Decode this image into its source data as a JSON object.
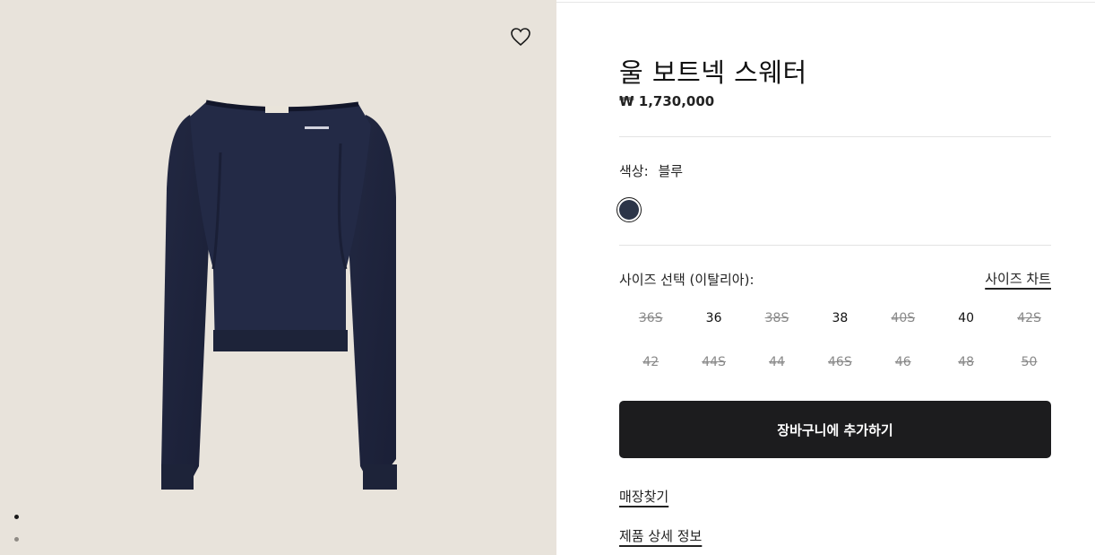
{
  "product": {
    "title": "울 보트넥 스웨터",
    "price": "₩ 1,730,000"
  },
  "color": {
    "label": "색상:",
    "value": "블루",
    "swatch_hex": "#2c3548"
  },
  "size": {
    "label": "사이즈 선택 (이탈리아):",
    "chart_link": "사이즈 차트",
    "options": [
      {
        "label": "36S",
        "available": false
      },
      {
        "label": "36",
        "available": true
      },
      {
        "label": "38S",
        "available": false
      },
      {
        "label": "38",
        "available": true
      },
      {
        "label": "40S",
        "available": false
      },
      {
        "label": "40",
        "available": true
      },
      {
        "label": "42S",
        "available": false
      },
      {
        "label": "42",
        "available": false
      },
      {
        "label": "44S",
        "available": false
      },
      {
        "label": "44",
        "available": false
      },
      {
        "label": "46S",
        "available": false
      },
      {
        "label": "46",
        "available": false
      },
      {
        "label": "48",
        "available": false
      },
      {
        "label": "50",
        "available": false
      }
    ]
  },
  "actions": {
    "add_to_cart": "장바구니에 추가하기",
    "find_store": "매장찾기",
    "product_details": "제품 상세 정보"
  },
  "gallery": {
    "image_count": 2,
    "active_index": 0,
    "background": "#e8e3db",
    "icons": {
      "wishlist": "heart-outline-icon"
    }
  }
}
